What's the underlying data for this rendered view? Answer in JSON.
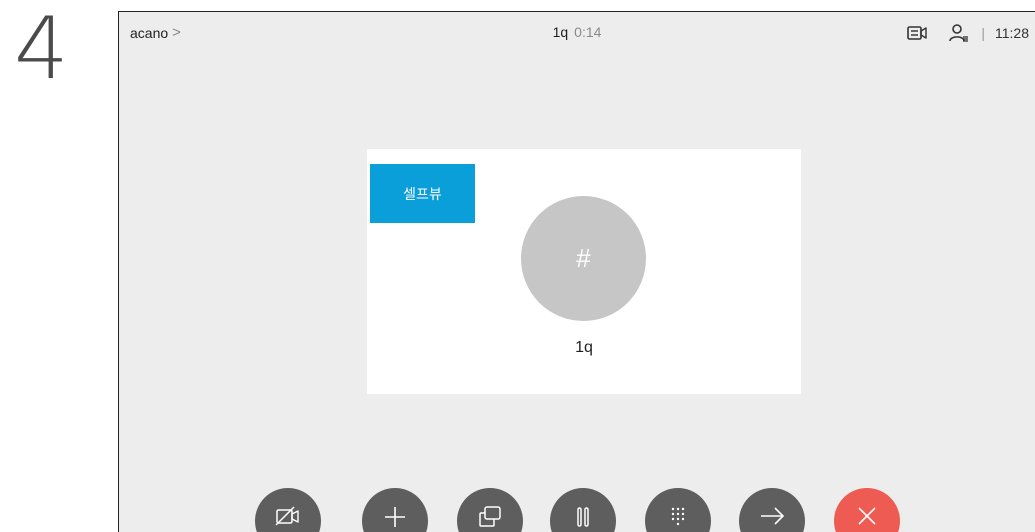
{
  "step": {
    "number": "4"
  },
  "topbar": {
    "breadcrumb": "acano",
    "breadcrumb_chevron": ">",
    "call_name": "1q",
    "call_timer": "0:14",
    "separator": "|",
    "clock": "11:28",
    "icons": [
      "camera-layout-icon",
      "participants-icon"
    ]
  },
  "video": {
    "selfview_label": "셀프뷰",
    "avatar_glyph": "#",
    "caller_name": "1q"
  },
  "controls": {
    "buttons": [
      {
        "name": "camera-off-button",
        "icon": "camera-off-icon"
      },
      {
        "name": "add-participant-button",
        "icon": "plus-icon"
      },
      {
        "name": "share-button",
        "icon": "share-icon"
      },
      {
        "name": "hold-button",
        "icon": "pause-icon"
      },
      {
        "name": "keypad-button",
        "icon": "keypad-icon"
      },
      {
        "name": "transfer-button",
        "icon": "arrow-right-icon"
      },
      {
        "name": "end-call-button",
        "icon": "close-icon"
      }
    ]
  },
  "colors": {
    "screen_bg": "#ededed",
    "selfview_blue": "#0a9fd8",
    "control_gray": "#5e5e5e",
    "end_call_red": "#ee5b52",
    "avatar_gray": "#c6c6c6"
  }
}
